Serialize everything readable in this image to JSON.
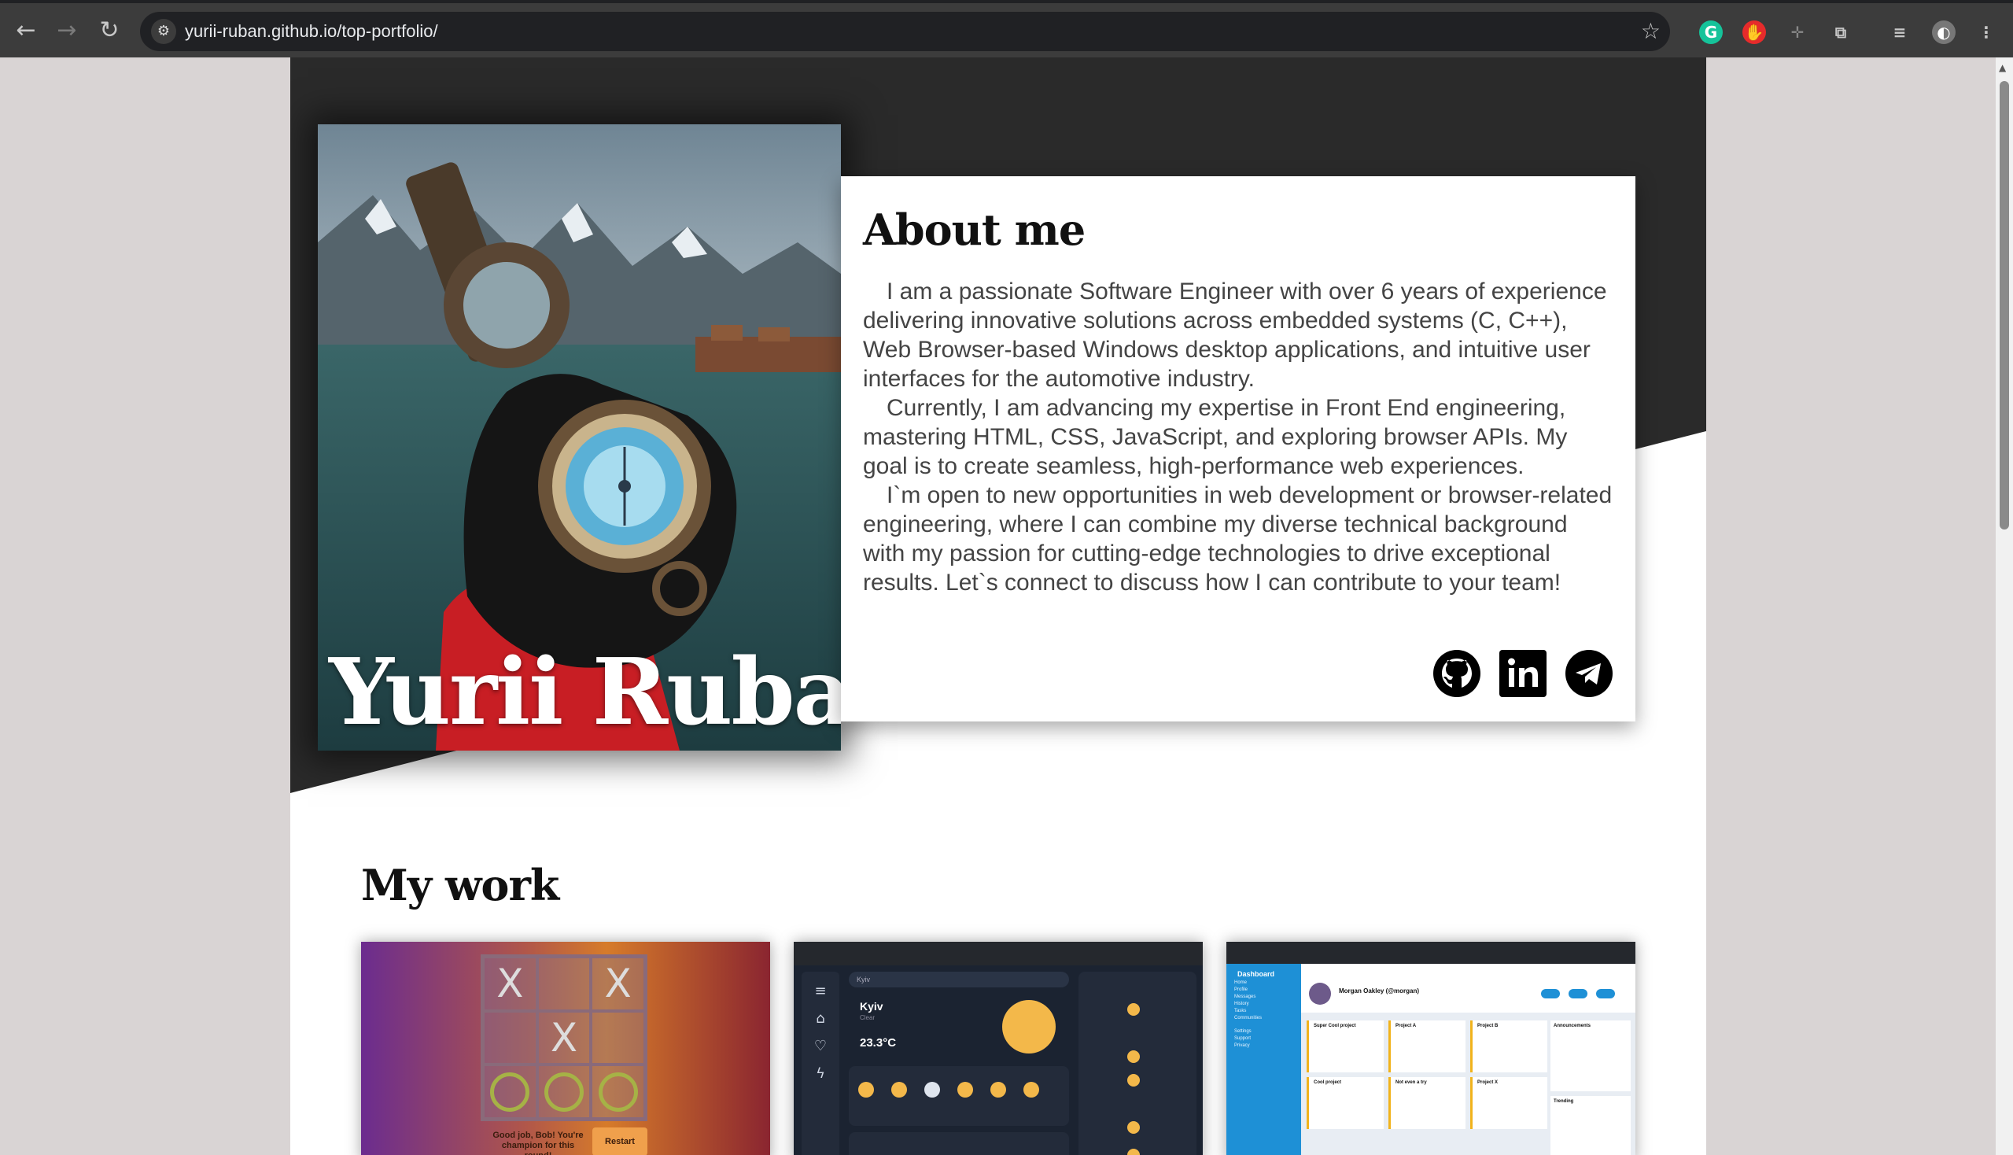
{
  "browser": {
    "url": "yurii-ruban.github.io/top-portfolio/",
    "back_icon": "←",
    "forward_icon": "→",
    "reload_icon": "↻",
    "star_icon": "☆",
    "menu_icon": "⋮"
  },
  "hero": {
    "name": "Yurii Ruban"
  },
  "about": {
    "title": "About me",
    "paragraphs": [
      "I am a passionate Software Engineer with over 6 years of experience delivering innovative solutions across embedded systems (C, C++), Web Browser-based Windows desktop applications, and intuitive user interfaces for the automotive industry.",
      "Currently, I am advancing my expertise in Front End engineering, mastering HTML, CSS, JavaScript, and exploring browser APIs. My goal is to create seamless, high-performance web experiences.",
      "I`m open to new opportunities in web development or browser-related engineering, where I can combine my diverse technical background with my passion for cutting-edge technologies to drive exceptional results. Let`s connect to discuss how I can contribute to your team!"
    ],
    "socials": [
      "github-icon",
      "linkedin-icon",
      "telegram-icon"
    ]
  },
  "work": {
    "title": "My work",
    "ttt": {
      "cells": [
        "X",
        "",
        "X",
        "",
        "X",
        "",
        "O",
        "O",
        "O"
      ],
      "message": "Good job, Bob! You're champion for this round!",
      "restart": "Restart"
    },
    "weather": {
      "search": "Kyiv",
      "city": "Kyiv",
      "condition": "Clear",
      "temp": "23.3°C"
    },
    "dashboard": {
      "sidebar_title": "Dashboard",
      "sidebar_items": [
        "Home",
        "Profile",
        "Messages",
        "History",
        "Tasks",
        "Communities",
        "Settings",
        "Support",
        "Privacy"
      ],
      "user": "Morgan Oakley (@morgan)",
      "projects": [
        "Super Cool project",
        "Project A",
        "Project B",
        "Cool project",
        "Not even a try",
        "Project X"
      ],
      "announcements": "Announcements",
      "trending": "Trending"
    }
  },
  "colors": {
    "hero_dark": "#2a2a2a",
    "accent_orange": "#f3b84a",
    "dashboard_blue": "#1e90d6"
  }
}
